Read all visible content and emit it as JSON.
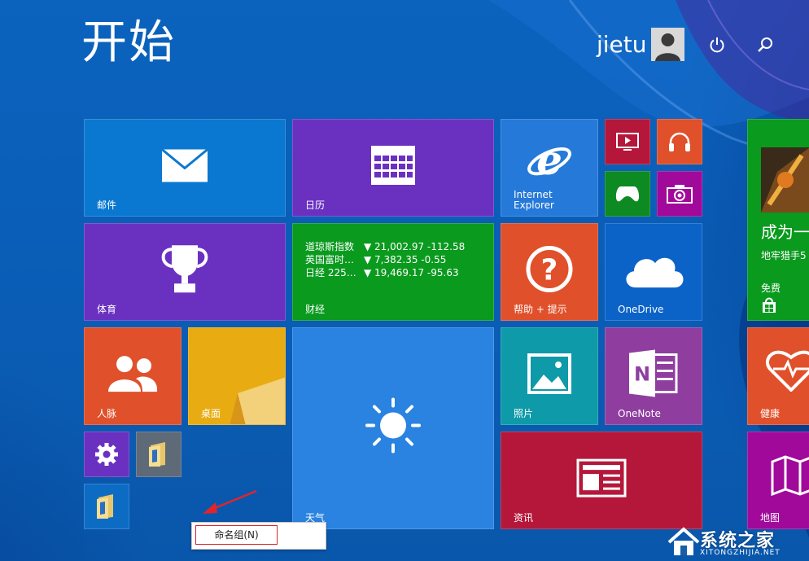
{
  "start": {
    "title": "开始",
    "user": {
      "name": "jietu"
    }
  },
  "tiles": {
    "mail": {
      "label": "邮件",
      "color": "#0a78d0"
    },
    "calendar": {
      "label": "日历",
      "color": "#6a31c1"
    },
    "ie": {
      "label_line1": "Internet",
      "label_line2": "Explorer",
      "color": "#2579d9"
    },
    "video": {
      "color": "#b5173a"
    },
    "music": {
      "color": "#e0502a"
    },
    "games": {
      "color": "#0d8a22"
    },
    "camera": {
      "color": "#a1099a"
    },
    "sports": {
      "label": "体育",
      "color": "#6a31c1"
    },
    "finance": {
      "label": "财经",
      "color": "#0a9a1e",
      "rows": [
        {
          "name": "道琼斯指数",
          "value": "▼ 21,002.97 -112.58"
        },
        {
          "name": "英国富时…",
          "value": "▼ 7,382.35 -0.55"
        },
        {
          "name": "日经 225…",
          "value": "▼ 19,469.17 -95.63"
        }
      ]
    },
    "help": {
      "label": "帮助 + 提示",
      "color": "#e0502a"
    },
    "onedrive": {
      "label": "OneDrive",
      "color": "#0b63c8"
    },
    "people": {
      "label": "人脉",
      "color": "#e0502a"
    },
    "desktop": {
      "label": "桌面",
      "color": "#e7a90f"
    },
    "weather": {
      "label": "天气",
      "color": "#2a83e0"
    },
    "photos": {
      "label": "照片",
      "color": "#0e9aa8"
    },
    "onenote": {
      "label": "OneNote",
      "color": "#8f3ea0"
    },
    "settings": {
      "color": "#6a31c1"
    },
    "news": {
      "label": "资讯",
      "color": "#b5173a"
    },
    "store_game": {
      "title": "成为一",
      "subtitle": "地牢猎手5",
      "price": "免费",
      "color": "#0a9a1e"
    },
    "health": {
      "label": "健康",
      "color": "#e0502a"
    },
    "maps": {
      "label": "地图",
      "color": "#a1099a"
    }
  },
  "context_menu": {
    "rename_group": "命名组(N)"
  },
  "watermark": {
    "text": "系统之家",
    "url": "XITONGZHIJIA.NET"
  }
}
